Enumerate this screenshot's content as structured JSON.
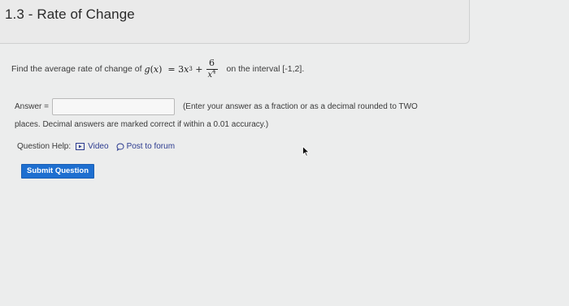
{
  "header": {
    "title": "1.3 - Rate of Change"
  },
  "question": {
    "prefix": "Find the average rate of change of",
    "function_name": "g",
    "variable": "x",
    "equals": "=",
    "coefficient": "3",
    "exponent": "3",
    "plus": "+",
    "fraction_numerator": "6",
    "denominator_exponent": "4",
    "interval_text": "on the interval [-1,2]."
  },
  "answer": {
    "label": "Answer =",
    "value": "",
    "placeholder": "",
    "instructions_line1": "(Enter your answer as a fraction or as a decimal rounded to TWO",
    "instructions_line2": "places. Decimal answers are marked correct if within a 0.01 accuracy.)"
  },
  "help": {
    "label": "Question Help:",
    "video_label": "Video",
    "forum_label": "Post to forum"
  },
  "submit": {
    "label": "Submit Question"
  },
  "colors": {
    "link": "#2b3a8f",
    "button": "#1e6fd0",
    "background": "#eceded"
  }
}
